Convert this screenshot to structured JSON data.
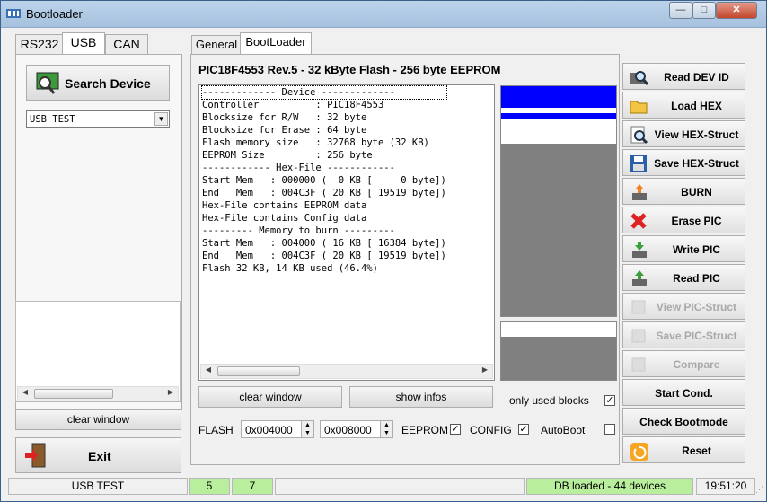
{
  "window": {
    "title": "Bootloader",
    "controls": {
      "minimize": "—",
      "maximize": "□",
      "close": "✕"
    }
  },
  "left_tabs": [
    "RS232",
    "USB",
    "CAN"
  ],
  "left": {
    "search_label": "Search Device",
    "device_select": "USB TEST",
    "clear_label": "clear window",
    "exit_label": "Exit"
  },
  "main_tabs": [
    "General",
    "BootLoader"
  ],
  "device_header": "PIC18F4553 Rev.5 - 32 kByte Flash - 256 byte EEPROM",
  "log_lines": [
    "------------- Device -------------",
    "Controller          : PIC18F4553",
    "Blocksize for R/W   : 32 byte",
    "Blocksize for Erase : 64 byte",
    "Flash memory size   : 32768 byte (32 KB)",
    "EEPROM Size         : 256 byte",
    "------------ Hex-File ------------",
    "Start Mem   : 000000 (  0 KB [     0 byte])",
    "End   Mem   : 004C3F ( 20 KB [ 19519 byte])",
    "Hex-File contains EEPROM data",
    "Hex-File contains Config data",
    "--------- Memory to burn ---------",
    "Start Mem   : 004000 ( 16 KB [ 16384 byte])",
    "End   Mem   : 004C3F ( 20 KB [ 19519 byte])",
    "Flash 32 KB, 14 KB used (46.4%)"
  ],
  "mid": {
    "clear_label": "clear window",
    "show_infos_label": "show infos",
    "only_used_label": "only used blocks",
    "only_used": true
  },
  "bottom": {
    "flash_label": "FLASH",
    "flash_start": "0x004000",
    "flash_end": "0x008000",
    "eeprom_label": "EEPROM",
    "eeprom": true,
    "config_label": "CONFIG",
    "config": true,
    "autoboot_label": "AutoBoot",
    "autoboot": false
  },
  "actions": [
    {
      "label": "Read DEV ID",
      "icon": "read-dev-id-icon",
      "enabled": true
    },
    {
      "label": "Load HEX",
      "icon": "folder-icon",
      "enabled": true
    },
    {
      "label": "View HEX-Struct",
      "icon": "magnifier-icon",
      "enabled": true
    },
    {
      "label": "Save HEX-Struct",
      "icon": "floppy-icon",
      "enabled": true
    },
    {
      "label": "BURN",
      "icon": "burn-icon",
      "enabled": true
    },
    {
      "label": "Erase PIC",
      "icon": "erase-x-icon",
      "enabled": true
    },
    {
      "label": "Write PIC",
      "icon": "write-chip-icon",
      "enabled": true
    },
    {
      "label": "Read PIC",
      "icon": "read-chip-icon",
      "enabled": true
    },
    {
      "label": "View PIC-Struct",
      "icon": "view-struct-icon",
      "enabled": false
    },
    {
      "label": "Save PIC-Struct",
      "icon": "save-struct-icon",
      "enabled": false
    },
    {
      "label": "Compare",
      "icon": "compare-icon",
      "enabled": false
    },
    {
      "label": "Start Cond.",
      "icon": "",
      "enabled": true
    },
    {
      "label": "Check Bootmode",
      "icon": "",
      "enabled": true
    },
    {
      "label": "Reset",
      "icon": "reset-icon",
      "enabled": true
    }
  ],
  "status": {
    "device": "USB TEST",
    "n1": "5",
    "n2": "7",
    "db": "DB loaded - 44 devices",
    "time": "19:51:20"
  },
  "colors": {
    "status_green": "#b8ee9c",
    "mem_blue": "#0000ff",
    "mem_gray": "#808080"
  }
}
